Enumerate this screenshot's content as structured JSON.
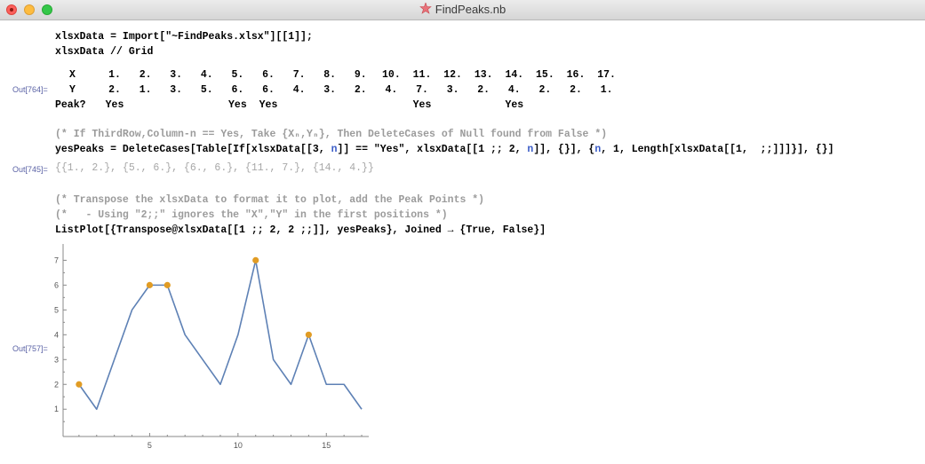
{
  "window": {
    "title": "FindPeaks.nb",
    "icon": "mathematica-spikey-icon"
  },
  "cells": {
    "import_line1": "xlsxData = Import[\"~FindPeaks.xlsx\"][[1]];",
    "import_line2": "xlsxData // Grid",
    "grid_out_label": "Out[764]=",
    "grid": {
      "x_header": "X",
      "y_header": "Y",
      "peak_header": "Peak?",
      "x": [
        "1.",
        "2.",
        "3.",
        "4.",
        "5.",
        "6.",
        "7.",
        "8.",
        "9.",
        "10.",
        "11.",
        "12.",
        "13.",
        "14.",
        "15.",
        "16.",
        "17."
      ],
      "y": [
        "2.",
        "1.",
        "3.",
        "5.",
        "6.",
        "6.",
        "4.",
        "3.",
        "2.",
        "4.",
        "7.",
        "3.",
        "2.",
        "4.",
        "2.",
        "2.",
        "1."
      ],
      "peak": [
        "Yes",
        "",
        "",
        "",
        "Yes",
        "Yes",
        "",
        "",
        "",
        "",
        "Yes",
        "",
        "",
        "Yes",
        "",
        "",
        ""
      ]
    },
    "comment1": "(* If ThirdRow,Column-n == Yes, Take {Xₙ,Yₙ}, Then DeleteCases of Null found from False *)",
    "yespeaks_prefix": "yesPeaks = DeleteCases[Table[If[xlsxData[[3, ",
    "yespeaks_n1": "n",
    "yespeaks_mid1": "]] == \"Yes\", xlsxData[[1 ;; 2, ",
    "yespeaks_n2": "n",
    "yespeaks_mid2": "]], {}], {",
    "yespeaks_n3": "n",
    "yespeaks_suffix": ", 1, Length[xlsxData[[1,  ;;]]]}], {}]",
    "yespeaks_out_label": "Out[745]=",
    "yespeaks_out": "{{1., 2.}, {5., 6.}, {6., 6.}, {11., 7.}, {14., 4.}}",
    "comment2": "(* Transpose the xlsxData to format it to plot, add the Peak Points *)",
    "comment3": "(*   - Using \"2;;\" ignores the \"X\",\"Y\" in the first positions *)",
    "plot_line": "ListPlot[{Transpose@xlsxData[[1 ;; 2, 2 ;;]], yesPeaks}, Joined → {True, False}]",
    "plot_out_label": "Out[757]="
  },
  "chart_data": {
    "type": "line",
    "series": [
      {
        "name": "",
        "color": "#5e81b5",
        "joined": true,
        "x": [
          1,
          2,
          3,
          4,
          5,
          6,
          7,
          8,
          9,
          10,
          11,
          12,
          13,
          14,
          15,
          16,
          17
        ],
        "y": [
          2,
          1,
          3,
          5,
          6,
          6,
          4,
          3,
          2,
          4,
          7,
          3,
          2,
          4,
          2,
          2,
          1
        ]
      },
      {
        "name": "",
        "color": "#e19c24",
        "joined": false,
        "x": [
          1,
          5,
          6,
          11,
          14
        ],
        "y": [
          2,
          6,
          6,
          7,
          4
        ]
      }
    ],
    "xticks": [
      "5",
      "10",
      "15"
    ],
    "yticks": [
      "1",
      "2",
      "3",
      "4",
      "5",
      "6",
      "7"
    ],
    "xlim": [
      0.1,
      17.3
    ],
    "ylim": [
      -0.1,
      7.3
    ],
    "grid": false,
    "title": "",
    "xlabel": "",
    "ylabel": ""
  }
}
